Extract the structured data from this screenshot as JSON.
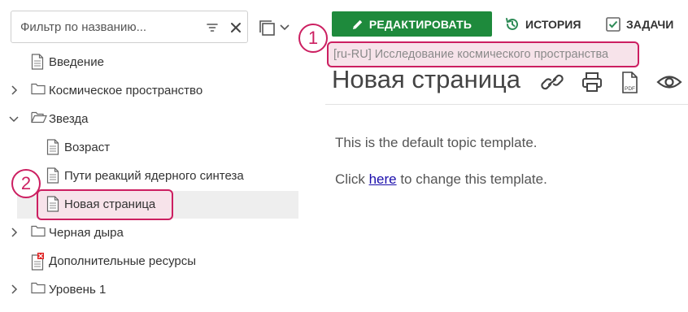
{
  "sidebar": {
    "filter": {
      "placeholder": "Фильтр по названию...",
      "value": ""
    },
    "tree": [
      {
        "label": "Введение",
        "icon": "page-icon",
        "toggle": "none"
      },
      {
        "label": "Космическое пространство",
        "icon": "folder-icon",
        "toggle": "collapsed"
      },
      {
        "label": "Звезда",
        "icon": "folder-open-icon",
        "toggle": "expanded"
      },
      {
        "label": "Возраст",
        "icon": "page-icon",
        "toggle": "none"
      },
      {
        "label": "Пути реакций ядерного синтеза",
        "icon": "page-icon",
        "toggle": "none"
      },
      {
        "label": "Новая страница",
        "icon": "page-icon",
        "toggle": "none",
        "selected": true
      },
      {
        "label": "Черная дыра",
        "icon": "folder-icon",
        "toggle": "collapsed"
      },
      {
        "label": "Дополнительные ресурсы",
        "icon": "page-error-icon",
        "toggle": "none"
      },
      {
        "label": "Уровень 1",
        "icon": "folder-icon",
        "toggle": "collapsed"
      }
    ]
  },
  "toolbar": {
    "edit_label": "РЕДАКТИРОВАТЬ",
    "history_label": "ИСТОРИЯ",
    "tasks_label": "ЗАДАЧИ"
  },
  "breadcrumb": "[ru-RU] Исследование космического пространства",
  "page": {
    "title": "Новая страница",
    "body_line1": "This is the default topic template.",
    "body_line2_before": "Click ",
    "body_line2_link": "here",
    "body_line2_after": " to change this template."
  },
  "callouts": {
    "one": "1",
    "two": "2"
  },
  "colors": {
    "accent": "#cc1f61",
    "edit_button": "#1e8a3c",
    "highlight_bg": "#f7e3ea",
    "selected_row_bg": "#eeeeee"
  }
}
